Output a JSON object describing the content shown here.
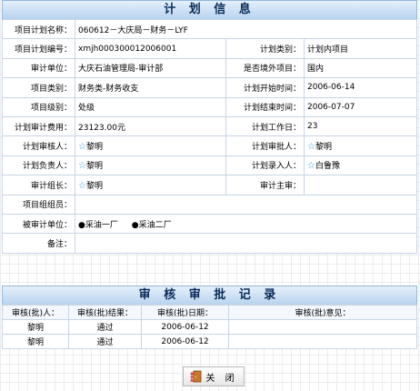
{
  "plan": {
    "title": "计 划 信 息",
    "rows": {
      "name": {
        "label": "项目计划名称：",
        "value": "060612－大庆局－财务－LYF"
      },
      "code": {
        "label": "项目计划编号：",
        "value": "xmjh000300012006001"
      },
      "category": {
        "label": "计划类别：",
        "value": "计划内项目"
      },
      "unit": {
        "label": "审计单位：",
        "value": "大庆石油管理局-审计部"
      },
      "abroad": {
        "label": "是否境外项目：",
        "value": "国内"
      },
      "type": {
        "label": "项目类别：",
        "value": "财务类-财务收支"
      },
      "start": {
        "label": "计划开始时间：",
        "value": "2006-06-14"
      },
      "level": {
        "label": "项目级别：",
        "value": "处级"
      },
      "end": {
        "label": "计划结束时间：",
        "value": "2006-07-07"
      },
      "cost": {
        "label": "计划审计费用：",
        "value": "23123.00元"
      },
      "workdays": {
        "label": "计划工作日：",
        "value": "23"
      },
      "reviewer": {
        "label": "计划审核人：",
        "value": "黎明"
      },
      "approver": {
        "label": "计划审批人：",
        "value": "黎明"
      },
      "owner": {
        "label": "计划负责人：",
        "value": "黎明"
      },
      "entered_by": {
        "label": "计划录入人：",
        "value": "白鲁豫"
      },
      "leader": {
        "label": "审计组长：",
        "value": "黎明"
      },
      "chief": {
        "label": "审计主审：",
        "value": ""
      },
      "members": {
        "label": "项目组组员：",
        "value": ""
      },
      "audited_units": {
        "label": "被审计单位：",
        "values": [
          "采油一厂",
          "采油二厂"
        ]
      },
      "remark": {
        "label": "备注：",
        "value": ""
      }
    }
  },
  "review": {
    "title": "审 核 审 批 记 录",
    "headers": [
      "审核(批)人：",
      "审核(批)结果：",
      "审核(批)日期：",
      "审核(批)意见："
    ],
    "rows": [
      [
        "黎明",
        "通过",
        "2006-06-12",
        ""
      ],
      [
        "黎明",
        "通过",
        "2006-06-12",
        ""
      ]
    ]
  },
  "close_button": {
    "label": "关 闭"
  },
  "icons": {
    "star": "☆",
    "bullet": "●"
  }
}
